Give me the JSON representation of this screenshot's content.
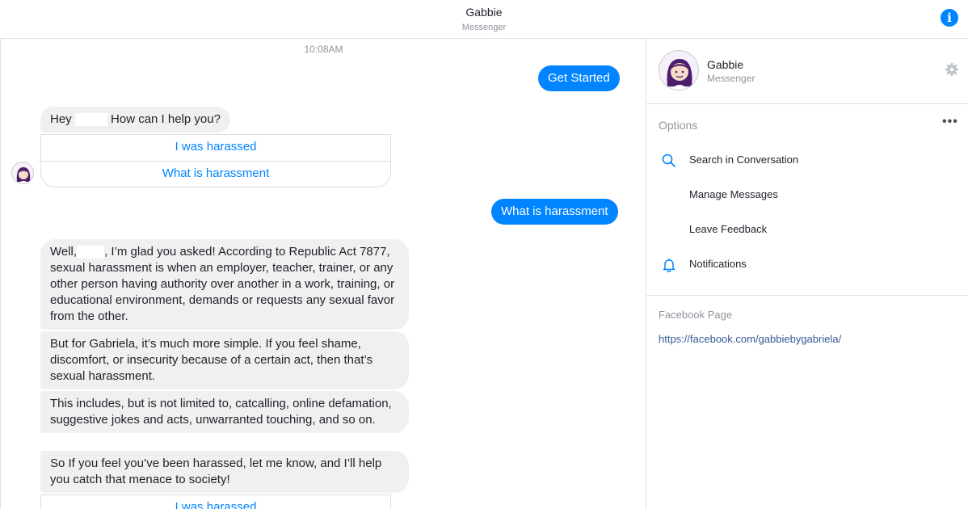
{
  "header": {
    "title": "Gabbie",
    "subtitle": "Messenger",
    "info_icon": "info-icon"
  },
  "chat": {
    "timestamp": "10:08AM",
    "messages": {
      "out_get_started": "Get Started",
      "in_greeting_a": "Hey",
      "in_greeting_b": "How can I help you?",
      "quick_1": [
        "I was harassed",
        "What is harassment"
      ],
      "out_what_is": "What is harassment",
      "in_def_1a": "Well,",
      "in_def_1b": ", I’m glad you asked! According to Republic Act 7877, sexual harassment is when an employer, teacher, trainer, or any other person having authority over another in a work, training, or educational environment, demands or requests any sexual favor from the other.",
      "in_def_2": "But for Gabriela, it’s much more simple. If you feel shame, discomfort, or insecurity because of a certain act, then that’s sexual harassment.",
      "in_def_3": "This includes, but is not limited to, catcalling, online defamation, suggestive jokes and acts, unwarranted touching, and so on.",
      "in_def_4": "So If you feel you’ve been harassed, let me know, and I’ll help you catch that menace to society!",
      "quick_2": [
        "I was harassed"
      ]
    }
  },
  "sidebar": {
    "name": "Gabbie",
    "subtitle": "Messenger",
    "options_title": "Options",
    "more_label": "•••",
    "items": [
      {
        "label": "Search in Conversation",
        "icon": "search-icon"
      },
      {
        "label": "Manage Messages",
        "icon": ""
      },
      {
        "label": "Leave Feedback",
        "icon": ""
      },
      {
        "label": "Notifications",
        "icon": "bell-icon"
      }
    ],
    "facebook_title": "Facebook Page",
    "facebook_link": "https://facebook.com/gabbiebygabriela/"
  },
  "colors": {
    "accent": "#0084ff",
    "bubble_in": "#f1f0f0",
    "border": "#dddfe2",
    "muted": "#90949c",
    "avatar_purple": "#4b1d6b"
  }
}
